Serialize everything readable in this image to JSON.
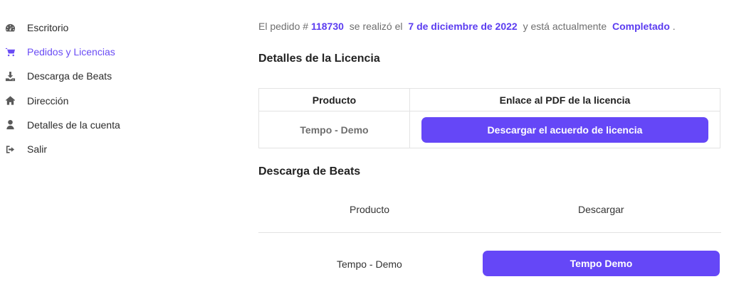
{
  "sidebar": {
    "items": [
      {
        "label": "Escritorio",
        "icon": "dashboard-icon"
      },
      {
        "label": "Pedidos y Licencias",
        "icon": "cart-icon",
        "active": true
      },
      {
        "label": "Descarga de Beats",
        "icon": "download-icon"
      },
      {
        "label": "Dirección",
        "icon": "home-icon"
      },
      {
        "label": "Detalles de la cuenta",
        "icon": "user-icon"
      },
      {
        "label": "Salir",
        "icon": "sign-out-icon"
      }
    ]
  },
  "order": {
    "prefix": "El pedido #",
    "number": "118730",
    "mid": "se realizó el",
    "date": "7 de diciembre de 2022",
    "mid2": "y está actualmente",
    "status": "Completado",
    "suffix": "."
  },
  "license_section": {
    "title": "Detalles de la Licencia",
    "col_product": "Producto",
    "col_link": "Enlace al PDF de la licencia",
    "rows": [
      {
        "product": "Tempo - Demo",
        "button": "Descargar el acuerdo de licencia"
      }
    ]
  },
  "beats_section": {
    "title": "Descarga de Beats",
    "col_product": "Producto",
    "col_download": "Descargar",
    "rows": [
      {
        "product": "Tempo - Demo",
        "button": "Tempo Demo"
      }
    ]
  },
  "colors": {
    "accent": "#6547f7",
    "active_link": "#6a4cf5",
    "text_muted": "#6e6e6e"
  }
}
